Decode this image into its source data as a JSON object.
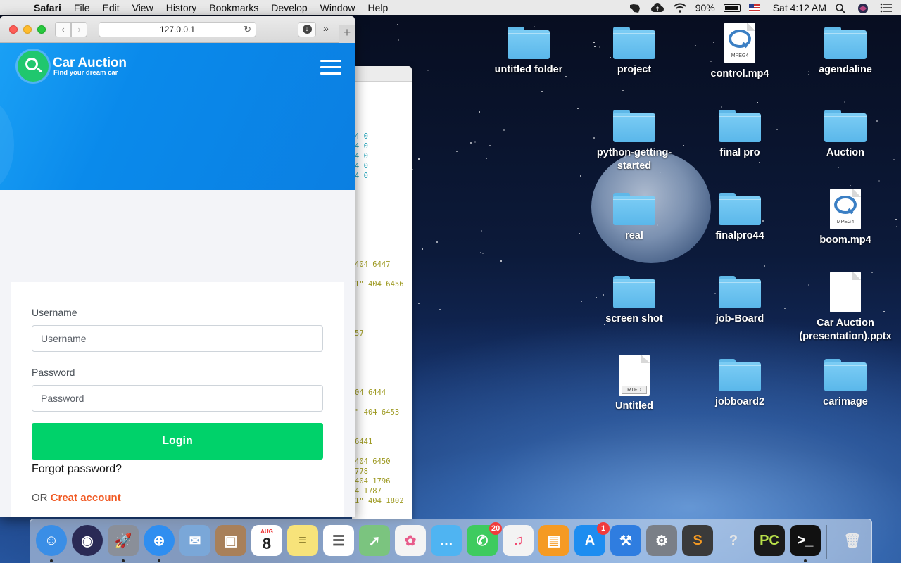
{
  "menubar": {
    "apple": "",
    "app": "Safari",
    "items": [
      "File",
      "Edit",
      "View",
      "History",
      "Bookmarks",
      "Develop",
      "Window",
      "Help"
    ],
    "battery": "90%",
    "clock": "Sat 4:12 AM"
  },
  "safari": {
    "url": "127.0.0.1",
    "back": "‹",
    "forward": "›",
    "reload": "↻",
    "download": "↓",
    "more": "»",
    "newtab": "+"
  },
  "site": {
    "brand_name": "Car Auction",
    "brand_tagline": "Find your dream car",
    "username_label": "Username",
    "username_placeholder": "Username",
    "password_label": "Password",
    "password_placeholder": "Password",
    "login_button": "Login",
    "forgot_password": "Forgot password?",
    "or_text": "OR",
    "create_account": "Creat account",
    "colors": {
      "header": "#0b86e8",
      "login_button": "#00d26a",
      "create_link": "#f15a24"
    }
  },
  "terminal_lines": [
    {
      "text": "4 0",
      "cls": "t-cyan"
    },
    {
      "text": "4 0",
      "cls": "t-cyan"
    },
    {
      "text": "4 0",
      "cls": "t-cyan"
    },
    {
      "text": "4 0",
      "cls": "t-cyan"
    },
    {
      "text": "4 0",
      "cls": "t-cyan"
    },
    {
      "text": "404 6447",
      "cls": "t-olive"
    },
    {
      "text": "1\" 404 6456",
      "cls": "t-olive"
    },
    {
      "text": "57",
      "cls": "t-olive"
    },
    {
      "text": "04 6444",
      "cls": "t-olive"
    },
    {
      "text": "\" 404 6453",
      "cls": "t-olive"
    },
    {
      "text": " 6441",
      "cls": "t-olive"
    },
    {
      "text": " 404 6450",
      "cls": "t-olive"
    },
    {
      "text": "778",
      "cls": "t-olive"
    },
    {
      "text": " 404 1796",
      "cls": "t-olive"
    },
    {
      "text": "4 1787",
      "cls": "t-olive"
    },
    {
      "text": "1\" 404 1802",
      "cls": "t-olive"
    }
  ],
  "desktop_icons": [
    {
      "label": "untitled folder",
      "type": "folder"
    },
    {
      "label": "project",
      "type": "folder"
    },
    {
      "label": "control.mp4",
      "type": "mp4",
      "badge": "MPEG4"
    },
    {
      "label": "agendaline",
      "type": "folder"
    },
    {
      "label": "python-getting-started",
      "type": "folder"
    },
    {
      "label": "final pro",
      "type": "folder"
    },
    {
      "label": "Auction",
      "type": "folder"
    },
    {
      "label": "real",
      "type": "folder"
    },
    {
      "label": "finalpro44",
      "type": "folder"
    },
    {
      "label": "boom.mp4",
      "type": "mp4",
      "badge": "MPEG4"
    },
    {
      "label": "screen shot",
      "type": "folder"
    },
    {
      "label": "job-Board",
      "type": "folder"
    },
    {
      "label": "Car Auction (presentation).pptx",
      "type": "doc"
    },
    {
      "label": "Untitled",
      "type": "rtfd",
      "badge": "RTFD"
    },
    {
      "label": "jobboard2",
      "type": "folder"
    },
    {
      "label": "carimage",
      "type": "folder"
    }
  ],
  "dock": [
    {
      "name": "finder",
      "glyph": "☺",
      "color": "#3a8ee6",
      "running": true
    },
    {
      "name": "siri",
      "glyph": "◉",
      "color": "#2a2a55"
    },
    {
      "name": "launchpad",
      "glyph": "🚀",
      "color": "#8a8f99",
      "running": true
    },
    {
      "name": "safari",
      "glyph": "⊕",
      "color": "#2f8ef0",
      "running": true
    },
    {
      "name": "mail",
      "glyph": "✉",
      "color": "#7aa7d8"
    },
    {
      "name": "contacts",
      "glyph": "▣",
      "color": "#a8805a"
    },
    {
      "name": "calendar",
      "glyph": "8",
      "color": "#ffffff",
      "text_color": "#222",
      "sub": "AUG"
    },
    {
      "name": "notes",
      "glyph": "≡",
      "color": "#f7e37a",
      "text_color": "#8a7a2a"
    },
    {
      "name": "reminders",
      "glyph": "☰",
      "color": "#ffffff",
      "text_color": "#555"
    },
    {
      "name": "maps",
      "glyph": "➚",
      "color": "#7bc47f"
    },
    {
      "name": "photos",
      "glyph": "✿",
      "color": "#f4f4f4",
      "text_color": "#e85b8a"
    },
    {
      "name": "messages",
      "glyph": "…",
      "color": "#4fb4f2"
    },
    {
      "name": "facetime",
      "glyph": "✆",
      "color": "#3ecb5f",
      "badge": "20"
    },
    {
      "name": "music",
      "glyph": "♫",
      "color": "#f3f3f3",
      "text_color": "#f2446c"
    },
    {
      "name": "books",
      "glyph": "▤",
      "color": "#f59a23"
    },
    {
      "name": "app-store",
      "glyph": "A",
      "color": "#1d8df0",
      "badge": "1"
    },
    {
      "name": "xcode",
      "glyph": "⚒",
      "color": "#2f7de0"
    },
    {
      "name": "system-preferences",
      "glyph": "⚙",
      "color": "#7a7f87"
    },
    {
      "name": "sublime-text",
      "glyph": "S",
      "color": "#3a3a3a",
      "text_color": "#f59a23"
    },
    {
      "name": "help",
      "glyph": "?",
      "color": "transparent",
      "text_color": "#e6e6e6"
    },
    {
      "name": "pycharm",
      "glyph": "PC",
      "color": "#1a1a1a",
      "text_color": "#b8e04a"
    },
    {
      "name": "terminal",
      "glyph": ">_",
      "color": "#111",
      "running": true
    },
    {
      "name": "trash",
      "glyph": "🗑",
      "color": "transparent",
      "text_color": "#e8e8e8"
    }
  ]
}
